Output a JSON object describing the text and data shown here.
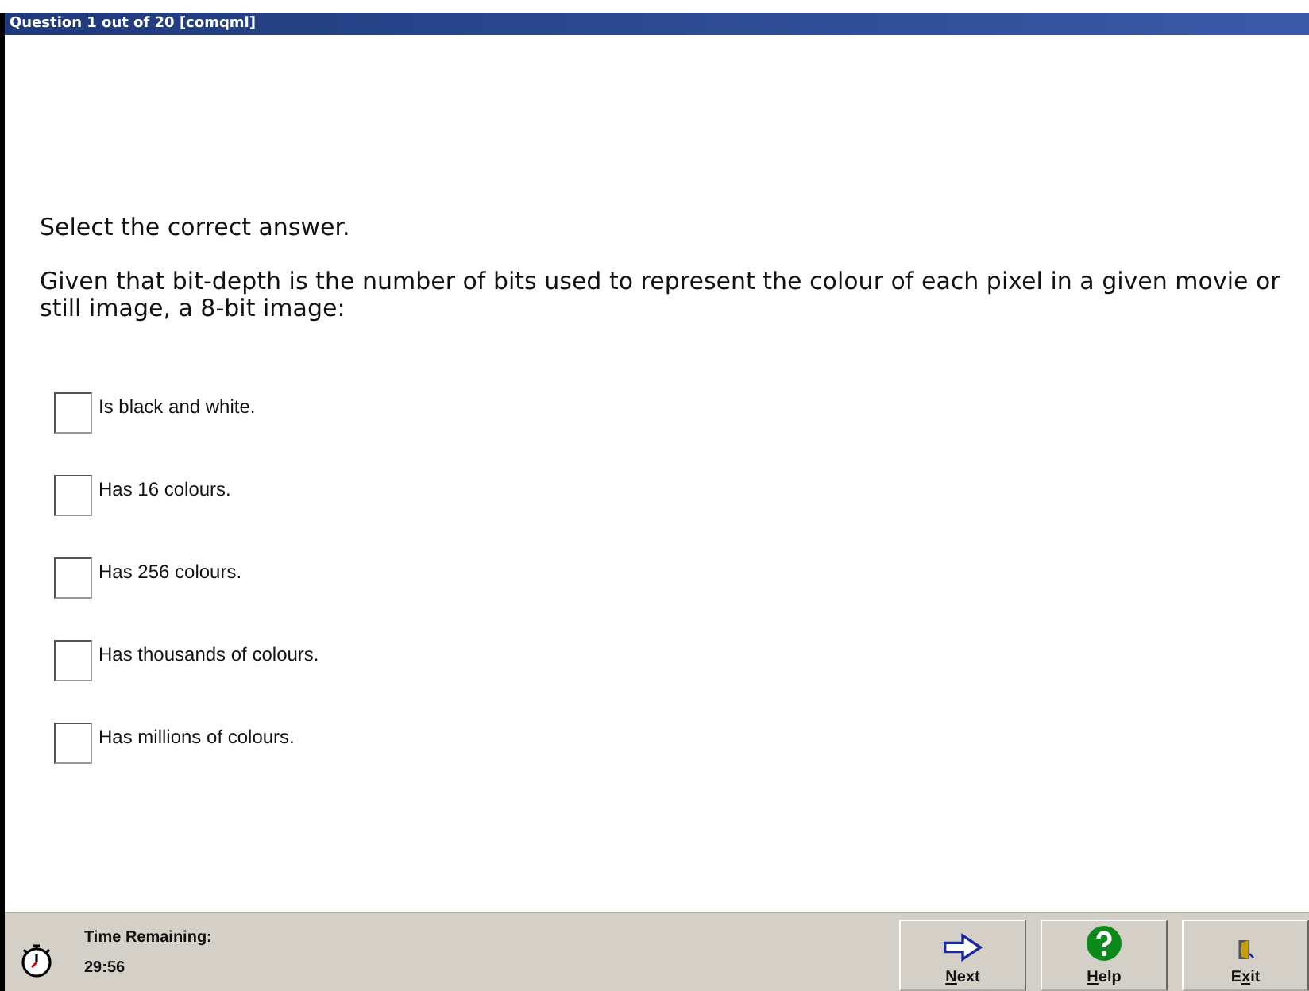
{
  "window": {
    "title": "Question 1 out of 20 [comqml]"
  },
  "instruction": "Select the correct answer.",
  "question": "Given that bit-depth is the number of bits used to represent the colour of each pixel in a given movie or still image, a 8-bit image:",
  "options": [
    {
      "label": "Is black and white.",
      "checked": false
    },
    {
      "label": "Has 16 colours.",
      "checked": false
    },
    {
      "label": "Has 256 colours.",
      "checked": false
    },
    {
      "label": "Has thousands of colours.",
      "checked": false
    },
    {
      "label": "Has millions of colours.",
      "checked": false
    }
  ],
  "status_bar": {
    "timer_label": "Time Remaining:",
    "time": "29:56"
  },
  "buttons": [
    {
      "kind": "next",
      "key": "N",
      "post": "ext"
    },
    {
      "kind": "help",
      "key": "H",
      "post": "elp"
    },
    {
      "kind": "exit",
      "pre": "E",
      "key": "x",
      "post": "it"
    }
  ]
}
